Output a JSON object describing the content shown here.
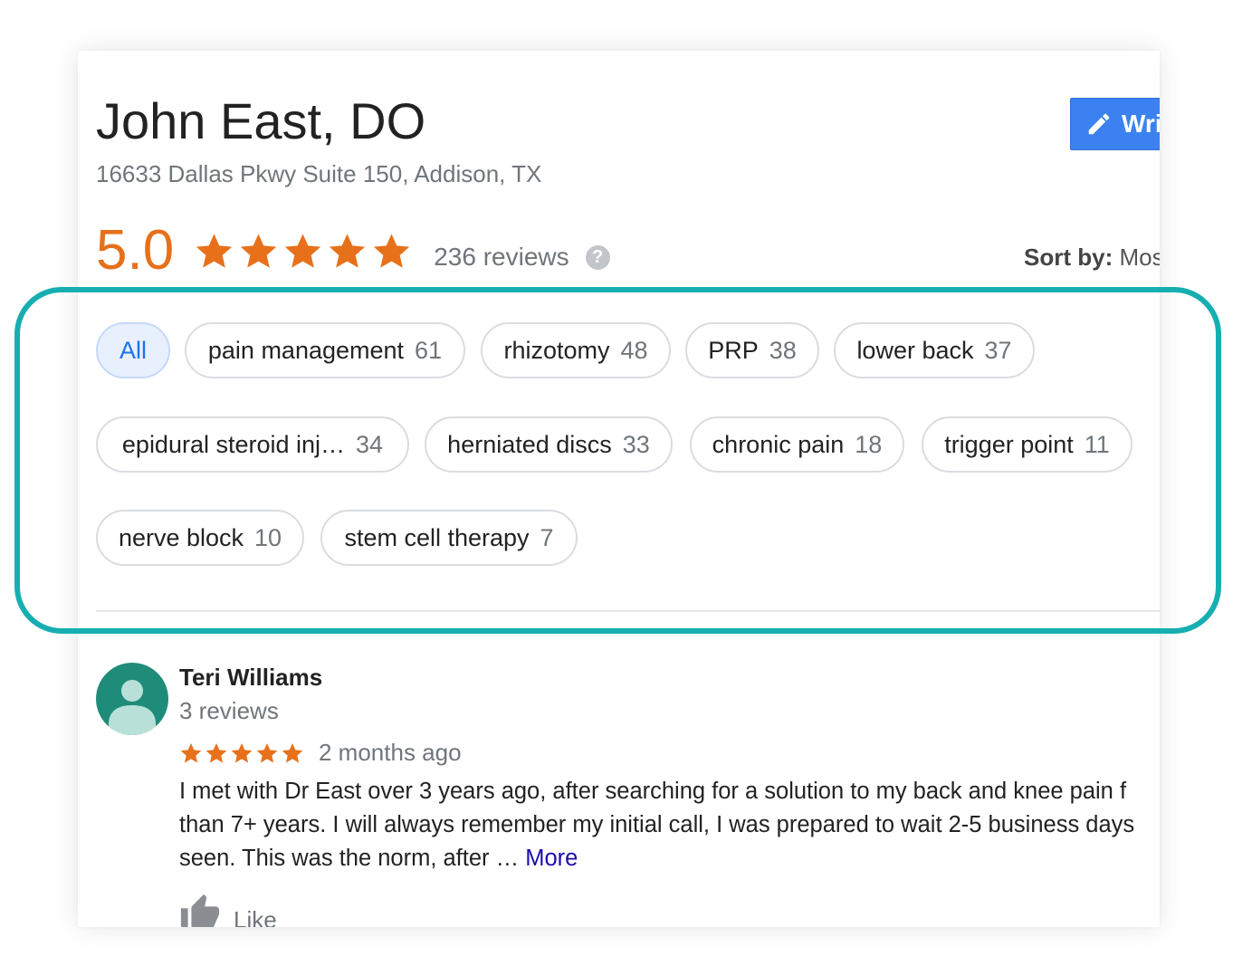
{
  "business": {
    "name": "John East, DO",
    "address": "16633 Dallas Pkwy Suite 150, Addison, TX"
  },
  "write_button": {
    "label": "Wri",
    "icon": "pencil-icon"
  },
  "rating": {
    "value": "5.0",
    "stars": 5,
    "reviews_text": "236 reviews",
    "help_icon": "?"
  },
  "sort": {
    "label": "Sort by:",
    "value": "Mos"
  },
  "topics": [
    {
      "label": "All",
      "count": "",
      "selected": true
    },
    {
      "label": "pain management",
      "count": "61"
    },
    {
      "label": "rhizotomy",
      "count": "48"
    },
    {
      "label": "PRP",
      "count": "38"
    },
    {
      "label": "lower back",
      "count": "37"
    },
    {
      "label": "epidural steroid inj…",
      "count": "34"
    },
    {
      "label": "herniated discs",
      "count": "33"
    },
    {
      "label": "chronic pain",
      "count": "18"
    },
    {
      "label": "trigger point",
      "count": "11"
    },
    {
      "label": "nerve block",
      "count": "10"
    },
    {
      "label": "stem cell therapy",
      "count": "7"
    }
  ],
  "review": {
    "author": "Teri Williams",
    "author_reviews": "3 reviews",
    "stars": 5,
    "date": "2 months ago",
    "text_lines": [
      "I met with Dr East over 3 years ago, after searching for a solution to my back and knee pain f",
      "than 7+ years. I will always remember my initial call, I was prepared to wait 2-5 business days",
      "seen. This was the norm, after … "
    ],
    "more_label": "More",
    "like_label": "Like"
  },
  "colors": {
    "rating": "#e7711b",
    "star": "#e7711b",
    "button": "#3b82f0",
    "highlight": "#17aeb1",
    "selected_chip_bg": "#e8f0fe",
    "selected_chip_text": "#1a73e8",
    "avatar": "#1f8c7a",
    "link": "#1a0dab"
  }
}
